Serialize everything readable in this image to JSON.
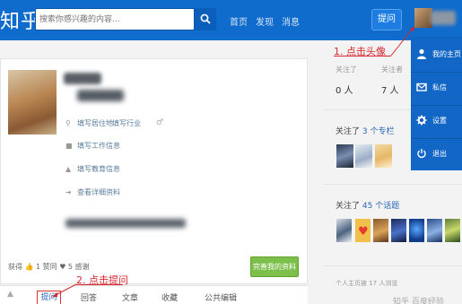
{
  "topbar": {
    "logo": "知乎",
    "search_placeholder": "搜索你感兴趣的内容...",
    "nav": [
      "首页",
      "发现",
      "消息"
    ],
    "ask_button": "提问"
  },
  "profile": {
    "info_items": [
      "填写居住地",
      "填写行业",
      "填写工作信息",
      "填写教育信息",
      "查看详细资料"
    ],
    "stats_text": "获得 👍 1 赞同 ♥ 5 感谢",
    "complete_button": "完善我的资料"
  },
  "tabs": {
    "ask": "提问",
    "items": [
      "回答",
      "文章",
      "收藏",
      "公共编辑"
    ]
  },
  "annotations": {
    "step1": "1. 点击头像",
    "step2": "2. 点击提问"
  },
  "right": {
    "following_label": "关注了",
    "followers_label": "关注者",
    "following_count": "0 人",
    "followers_count": "7 人",
    "columns_prefix": "关注了 ",
    "columns_count": "3 个专栏",
    "topics_prefix": "关注了 ",
    "topics_count": "45 个话题",
    "visits": "个人主页被 17 人浏览"
  },
  "dropdown": {
    "items": [
      "我的主页",
      "私信",
      "设置",
      "退出"
    ]
  },
  "watermark": "知乎 百度经验",
  "colors": {
    "topbar": "#0f6bcc",
    "dropdown": "#1266c5",
    "annotation": "#d9262c",
    "complete_button": "#7cbf4a"
  }
}
